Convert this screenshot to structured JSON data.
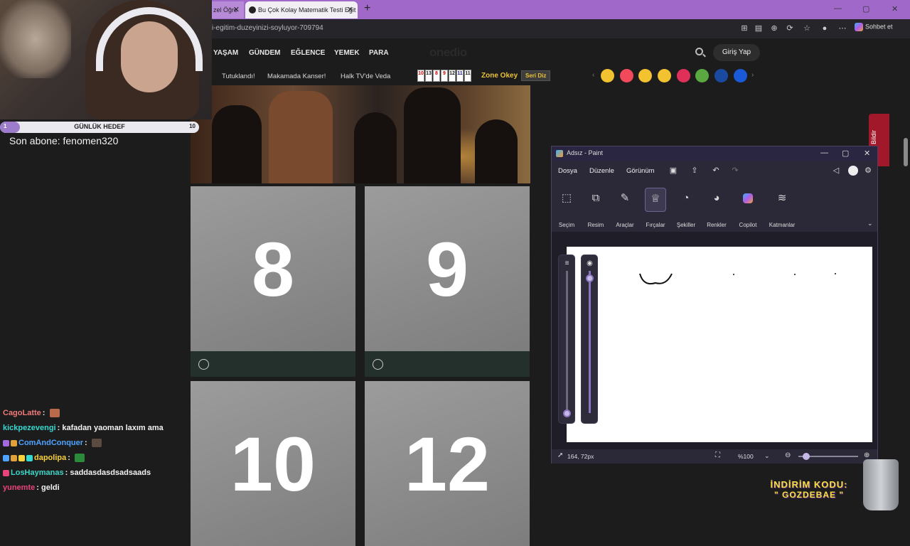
{
  "browser": {
    "tabs": [
      {
        "label": "zel Öğre",
        "close": "✕"
      },
      {
        "label": "Bu Çok Kolay Matematik Testi Eğit",
        "close": "✕"
      }
    ],
    "new_tab": "+",
    "window_controls": [
      "—",
      "▢",
      "✕"
    ],
    "url": "i-egitim-duzeyinizi-soyluyor-709794",
    "chat_button": "Sohbet et"
  },
  "site": {
    "logo": "onedio",
    "nav": [
      "YAŞAM",
      "GÜNDEM",
      "EĞLENCE",
      "YEMEK",
      "PARA"
    ],
    "login": "Giriş Yap",
    "ticker": [
      "Tutuklandı!",
      "Makamada Kanser!",
      "Halk TV'de Veda"
    ],
    "okey_tiles": [
      "10",
      "13",
      "8",
      "9",
      "12",
      "11",
      "11"
    ],
    "zone_okey": "Zone Okey",
    "seri_diz": "Seri Diz",
    "emoji_colors": [
      "#f2c230",
      "#f24a5a",
      "#f2c230",
      "#f2c230",
      "#e0305a",
      "#5aa840",
      "#1a4aa0",
      "#1a5ad8"
    ],
    "answers": [
      "8",
      "9",
      "10",
      "12"
    ]
  },
  "overlay": {
    "goal_title": "GÜNLÜK HEDEF",
    "goal_current": "1",
    "goal_max": "10",
    "goal_progress": 0.1,
    "last_sub": "Son abone: fenomen320",
    "chat": [
      {
        "user": "CagoLatte",
        "color": "#f07a7a",
        "text": ""
      },
      {
        "user": "kickpezevengi",
        "color": "#36d9d0",
        "text": "kafadan yaoman laxım ama"
      },
      {
        "user": "ComAndConquer",
        "color": "#4ea3ff",
        "text": ""
      },
      {
        "user": "dapolipa",
        "color": "#f7d23a",
        "text": ""
      },
      {
        "user": "LosHaymanas",
        "color": "#3ad6c8",
        "text": "saddasdasdsadsaads"
      },
      {
        "user": "yunemte",
        "color": "#e8447a",
        "text": "geldi"
      }
    ],
    "promo_line1": "İNDİRİM KODU:",
    "promo_line2": "\" GOZDEBAE \"",
    "feedback": "Görüş Bildir"
  },
  "paint": {
    "title": "Adsız - Paint",
    "menu": [
      "Dosya",
      "Düzenle",
      "Görünüm"
    ],
    "ribbon": [
      "Seçim",
      "Resim",
      "Araçlar",
      "Fırçalar",
      "Şekiller",
      "Renkler",
      "Copilot",
      "Katmanlar"
    ],
    "cursor_pos": "164, 72px",
    "zoom": "%100",
    "brush_size_level": 0.0,
    "opacity_level": 0.95
  }
}
